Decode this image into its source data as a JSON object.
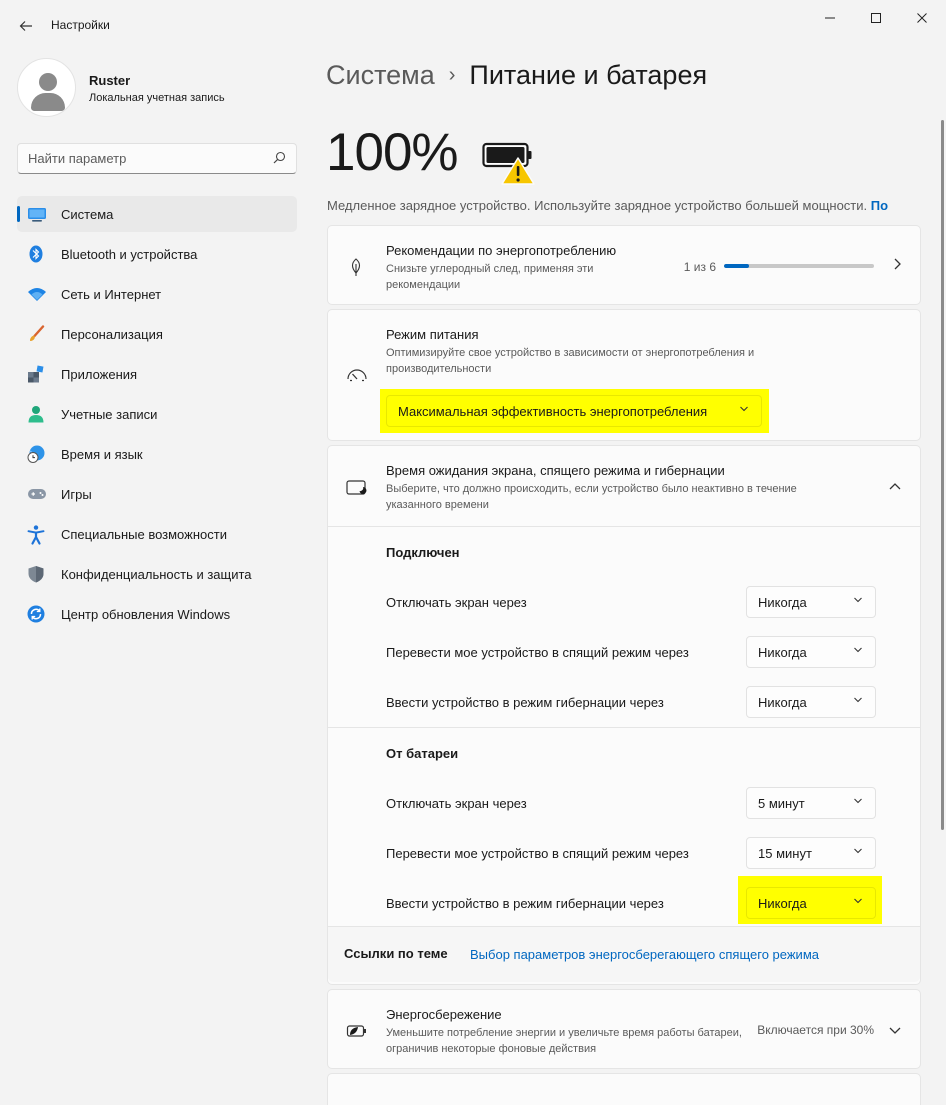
{
  "window": {
    "title": "Настройки",
    "minimize": "—",
    "maximize": "☐",
    "close": "✕"
  },
  "user": {
    "name": "Ruster",
    "account_type": "Локальная учетная запись"
  },
  "search": {
    "placeholder": "Найти параметр"
  },
  "sidebar": {
    "items": [
      {
        "label": "Система",
        "icon": "system-icon",
        "active": true
      },
      {
        "label": "Bluetooth и устройства",
        "icon": "bluetooth-icon"
      },
      {
        "label": "Сеть и Интернет",
        "icon": "wifi-icon"
      },
      {
        "label": "Персонализация",
        "icon": "brush-icon"
      },
      {
        "label": "Приложения",
        "icon": "apps-icon"
      },
      {
        "label": "Учетные записи",
        "icon": "account-icon"
      },
      {
        "label": "Время и язык",
        "icon": "globe-clock-icon"
      },
      {
        "label": "Игры",
        "icon": "gamepad-icon"
      },
      {
        "label": "Специальные возможности",
        "icon": "accessibility-icon"
      },
      {
        "label": "Конфиденциальность и защита",
        "icon": "shield-icon"
      },
      {
        "label": "Центр обновления Windows",
        "icon": "update-icon"
      }
    ]
  },
  "breadcrumb": {
    "parent": "Система",
    "separator": "›",
    "current": "Питание и батарея"
  },
  "battery": {
    "percent": "100%",
    "warning_text": "Медленное зарядное устройство. Используйте зарядное устройство большей мощности.",
    "warning_link": "По"
  },
  "recommendations": {
    "title": "Рекомендации по энергопотреблению",
    "description": "Снизьте углеродный след, применяя эти рекомендации",
    "progress_text": "1 из 6",
    "progress_fraction": 0.167
  },
  "power_mode": {
    "title": "Режим питания",
    "description": "Оптимизируйте свое устройство в зависимости от энергопотребления и производительности",
    "selected": "Максимальная эффективность энергопотребления"
  },
  "sleep": {
    "title": "Время ожидания экрана, спящего режима и гибернации",
    "description": "Выберите, что должно происходить, если устройство было неактивно в течение указанного времени",
    "plugged_in": {
      "heading": "Подключен",
      "rows": [
        {
          "label": "Отключать экран через",
          "value": "Никогда"
        },
        {
          "label": "Перевести мое устройство в спящий режим через",
          "value": "Никогда"
        },
        {
          "label": "Ввести устройство в режим гибернации через",
          "value": "Никогда"
        }
      ]
    },
    "on_battery": {
      "heading": "От батареи",
      "rows": [
        {
          "label": "Отключать экран через",
          "value": "5 минут"
        },
        {
          "label": "Перевести мое устройство в спящий режим через",
          "value": "15 минут"
        },
        {
          "label": "Ввести устройство в режим гибернации через",
          "value": "Никогда"
        }
      ]
    },
    "related_title": "Ссылки по теме",
    "related_link": "Выбор параметров энергосберегающего спящего режима"
  },
  "energy_saver": {
    "title": "Энергосбережение",
    "description": "Уменьшите потребление энергии и увеличьте время работы батареи, ограничив некоторые фоновые действия",
    "status": "Включается при 30%"
  },
  "colors": {
    "accent": "#0067c0",
    "highlight": "#ffff00",
    "warning": "#f7c600"
  }
}
